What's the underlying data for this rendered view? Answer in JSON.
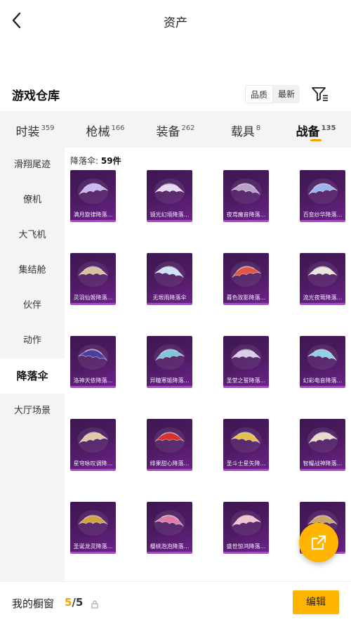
{
  "header": {
    "title": "资产"
  },
  "section": {
    "title": "游戏仓库",
    "sort_options": [
      {
        "label": "品质",
        "active": true
      },
      {
        "label": "最新",
        "active": false
      }
    ]
  },
  "tabs": [
    {
      "label": "时装",
      "count": "359",
      "active": false
    },
    {
      "label": "枪械",
      "count": "166",
      "active": false
    },
    {
      "label": "装备",
      "count": "262",
      "active": false
    },
    {
      "label": "载具",
      "count": "8",
      "active": false
    },
    {
      "label": "战备",
      "count": "135",
      "active": true
    }
  ],
  "sidebar": {
    "items": [
      {
        "label": "滑翔尾迹",
        "active": false
      },
      {
        "label": "僚机",
        "active": false
      },
      {
        "label": "大飞机",
        "active": false
      },
      {
        "label": "集结舱",
        "active": false
      },
      {
        "label": "伙伴",
        "active": false
      },
      {
        "label": "动作",
        "active": false
      },
      {
        "label": "降落伞",
        "active": true
      },
      {
        "label": "大厅场景",
        "active": false
      }
    ]
  },
  "content": {
    "category_label": "降落伞:",
    "count_text": "59件",
    "items": [
      {
        "name": "满月旋律降落...",
        "color": "#c9b8f2"
      },
      {
        "name": "镜光幻境降落...",
        "color": "#e8d8f4"
      },
      {
        "name": "夜鸢魔音降落...",
        "color": "#b8a2c8"
      },
      {
        "name": "百变纱华降落...",
        "color": "#9ab4f0"
      },
      {
        "name": "灵羽仙姬降落...",
        "color": "#d9c2a0"
      },
      {
        "name": "无垠雨降落伞",
        "color": "#cfe3f7"
      },
      {
        "name": "暮色玫影降落...",
        "color": "#e2553f"
      },
      {
        "name": "流光夜莺降落...",
        "color": "#ebe6dc"
      },
      {
        "name": "洛神天依降落...",
        "color": "#4a3fa0"
      },
      {
        "name": "异瞳寒姬降落...",
        "color": "#7cc6e0"
      },
      {
        "name": "圣堂之誓降落...",
        "color": "#d9cfe9"
      },
      {
        "name": "幻彩电音降落...",
        "color": "#8bd3e6"
      },
      {
        "name": "星穹咏叹调降...",
        "color": "#e0c9a8"
      },
      {
        "name": "绯果甜心降落...",
        "color": "#d8302a"
      },
      {
        "name": "圣斗士星矢降...",
        "color": "#e6c14a"
      },
      {
        "name": "智耀战神降落...",
        "color": "#e8dcc8"
      },
      {
        "name": "圣诞龙灵降落...",
        "color": "#d4a441"
      },
      {
        "name": "樱桃泡泡降落...",
        "color": "#e07aa8"
      },
      {
        "name": "盛世惊鸿降落...",
        "color": "#f2c4cf"
      },
      {
        "name": "",
        "color": "#c9a86a"
      }
    ]
  },
  "bottom": {
    "window_label": "我的橱窗",
    "used": "5",
    "total": "/5",
    "edit_label": "编辑"
  }
}
